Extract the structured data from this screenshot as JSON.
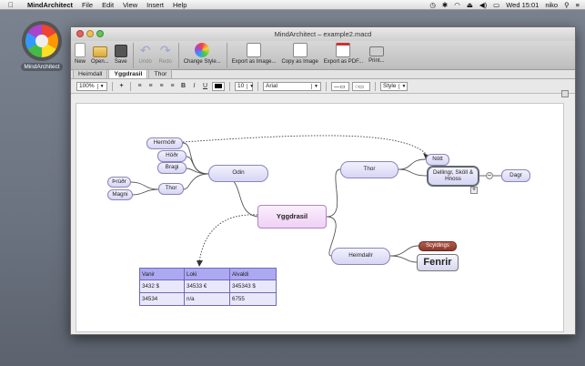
{
  "menubar": {
    "apple": "",
    "app_name": "MindArchitect",
    "menus": [
      "File",
      "Edit",
      "View",
      "Insert",
      "Help"
    ],
    "clock": "Wed 15:01",
    "user": "niko"
  },
  "desktop": {
    "icon_label": "MindArchitect"
  },
  "window": {
    "title": "MindArchitect – example2.macd",
    "toolbar": {
      "new": "New",
      "open": "Open...",
      "save": "Save",
      "undo": "Undo",
      "redo": "Redo",
      "change_style": "Change Style...",
      "export_image": "Export as Image...",
      "copy_image": "Copy as Image",
      "export_pdf": "Export as PDF...",
      "print": "Print..."
    },
    "tabs": [
      "Heimdall",
      "Yggdrasil",
      "Thor"
    ],
    "active_tab": "Yggdrasil",
    "format": {
      "zoom": "100%",
      "font_size": "10",
      "font": "Arial",
      "style": "Style"
    }
  },
  "mindmap": {
    "root": "Yggdrasil",
    "nodes": {
      "odin": "Odin",
      "hermodr": "Hermóðr",
      "hodr": "Höðr",
      "bragi": "Bragi",
      "thor_left": "Thor",
      "thrudr": "Þrúðr",
      "magni": "Magni",
      "thor_right": "Thor",
      "nott": "Nótt",
      "dellingr": "Dellingr, Sköll & Hnoss",
      "dagr": "Dagr",
      "heimdallr": "Heimdallr",
      "scyldings": "Scyldings",
      "fenrir": "Fenrir"
    },
    "table": {
      "headers": [
        "Vanir",
        "Loki",
        "Alvaldi"
      ],
      "rows": [
        [
          "3432 $",
          "34533 €",
          "345343 $"
        ],
        [
          "34534",
          "n/a",
          "6755"
        ]
      ]
    }
  },
  "colors": {
    "node_fill": "#d7d5f4",
    "root_fill": "#efd0f5",
    "table_header": "#aca8f2",
    "scyldings": "#9a4537"
  }
}
